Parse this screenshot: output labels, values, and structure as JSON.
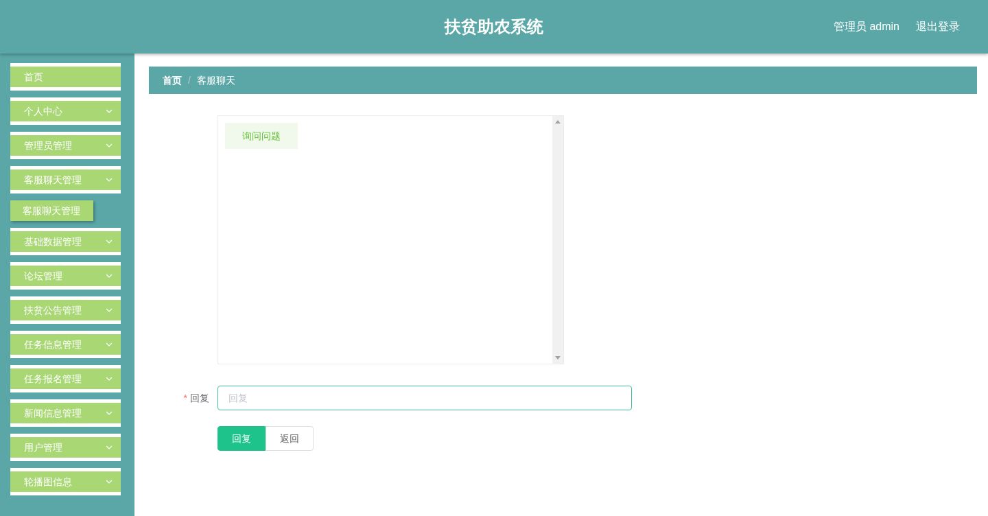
{
  "header": {
    "title": "扶贫助农系统",
    "user": "管理员 admin",
    "logout": "退出登录"
  },
  "sidebar": {
    "items": [
      {
        "label": "首页",
        "kind": "link"
      },
      {
        "label": "个人中心",
        "kind": "submenu"
      },
      {
        "label": "管理员管理",
        "kind": "submenu"
      },
      {
        "label": "客服聊天管理",
        "kind": "submenu",
        "children": [
          {
            "label": "客服聊天管理"
          }
        ]
      },
      {
        "label": "基础数据管理",
        "kind": "submenu"
      },
      {
        "label": "论坛管理",
        "kind": "submenu"
      },
      {
        "label": "扶贫公告管理",
        "kind": "submenu"
      },
      {
        "label": "任务信息管理",
        "kind": "submenu"
      },
      {
        "label": "任务报名管理",
        "kind": "submenu"
      },
      {
        "label": "新闻信息管理",
        "kind": "submenu"
      },
      {
        "label": "用户管理",
        "kind": "submenu"
      },
      {
        "label": "轮播图信息",
        "kind": "submenu"
      }
    ]
  },
  "breadcrumb": {
    "items": [
      "首页",
      "客服聊天"
    ],
    "separator": "/"
  },
  "chat": {
    "messages": [
      {
        "text": "询问问题"
      }
    ]
  },
  "form": {
    "label": "回复",
    "required_mark": "*",
    "placeholder": "回复"
  },
  "buttons": [
    {
      "label": "回复",
      "kind": "primary"
    },
    {
      "label": "返回",
      "kind": "default"
    }
  ]
}
